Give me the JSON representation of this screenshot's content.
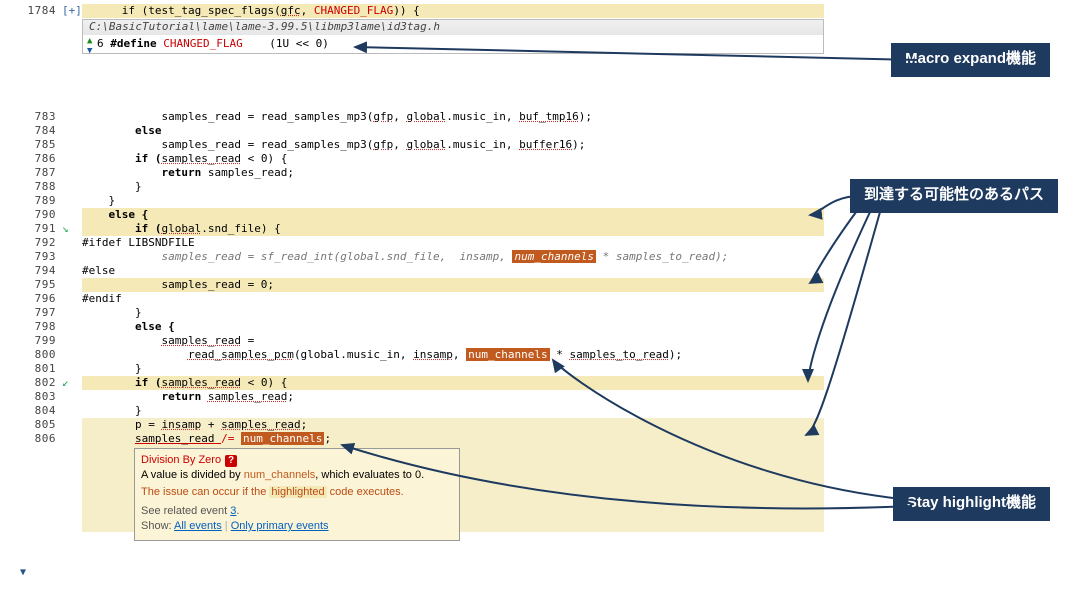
{
  "topLine": "1784",
  "plus": "[+]",
  "header": {
    "code_prefix": "      if (",
    "call": "test_tag_spec_flags",
    "args_prefix": "(",
    "arg1": "gfc",
    "args_sep": ", ",
    "flag": "CHANGED_FLAG",
    "args_suffix": ")) {"
  },
  "pathbar": "C:\\BasicTutorial\\lame\\lame-3.99.5\\libmp3lame\\id3tag.h",
  "macro": {
    "ln": "6",
    "def": " #define ",
    "name": "CHANGED_FLAG",
    "val": "    (1U << 0)"
  },
  "lines": {
    "783": "            samples_read = read_samples_mp3(",
    "783a": "gfp",
    "783b": ", ",
    "783c": "global",
    "783d": ".music_in, ",
    "783e": "buf_tmp16",
    "783f": ");",
    "784": "        else",
    "785": "            samples_read = read_samples_mp3(",
    "785a": "gfp",
    "785b": ", ",
    "785c": "global",
    "785d": ".music_in, ",
    "785e": "buffer16",
    "785f": ");",
    "786_a": "        if (",
    "786_b": "samples_read",
    "786_c": " < 0) {",
    "787": "            return samples_read;",
    "788": "        }",
    "789": "    }",
    "790": "    else {",
    "791_a": "        if (",
    "791_b": "global",
    "791_c": ".snd_file) {",
    "792": "#ifdef LIBSNDFILE",
    "793_a": "            samples_read = sf_read_int(global.snd_file,  insamp, ",
    "793_b": "num_channels",
    "793_c": " * samples_to_read);",
    "794": "#else",
    "795": "            samples_read = 0;",
    "796": "#endif",
    "797": "        }",
    "798": "        else {",
    "799_a": "            ",
    "799_b": "samples_read",
    "799_c": " =",
    "800_a": "                ",
    "800_b": "read_samples_pcm",
    "800_c": "(global.music_in, ",
    "800_d": "insamp",
    "800_e": ", ",
    "800_f": "num_channels",
    "800_g": " * ",
    "800_h": "samples_to_read",
    "800_i": ");",
    "801": "        }",
    "802_a": "        if (",
    "802_b": "samples_read",
    "802_c": " < 0) {",
    "803_a": "            return ",
    "803_b": "samples_read",
    "803_c": ";",
    "804": "        }",
    "805_a": "        p = ",
    "805_b": "insamp",
    "805_c": " + ",
    "805_d": "samples_read",
    "805_e": ";",
    "806_a": "        ",
    "806_b": "samples_read ",
    "806_c": "/= ",
    "806_d": "num_channels",
    "806_e": ";"
  },
  "err": {
    "title": "Division By Zero",
    "l1a": "A value is divided by ",
    "l1b": "num_channels",
    "l1c": ", which evaluates to 0.",
    "l2a": "The issue can occur if the ",
    "l2b": "highlighted",
    "l2c": " code executes.",
    "see": "See related event ",
    "three": "3",
    "dot": ".",
    "show": "Show:  ",
    "all": "All events",
    "only": "Only primary events"
  },
  "anno": {
    "macro": "Macro expand機能",
    "paths": "到達する可能性のあるパス",
    "stay": "Stay highlight機能"
  }
}
